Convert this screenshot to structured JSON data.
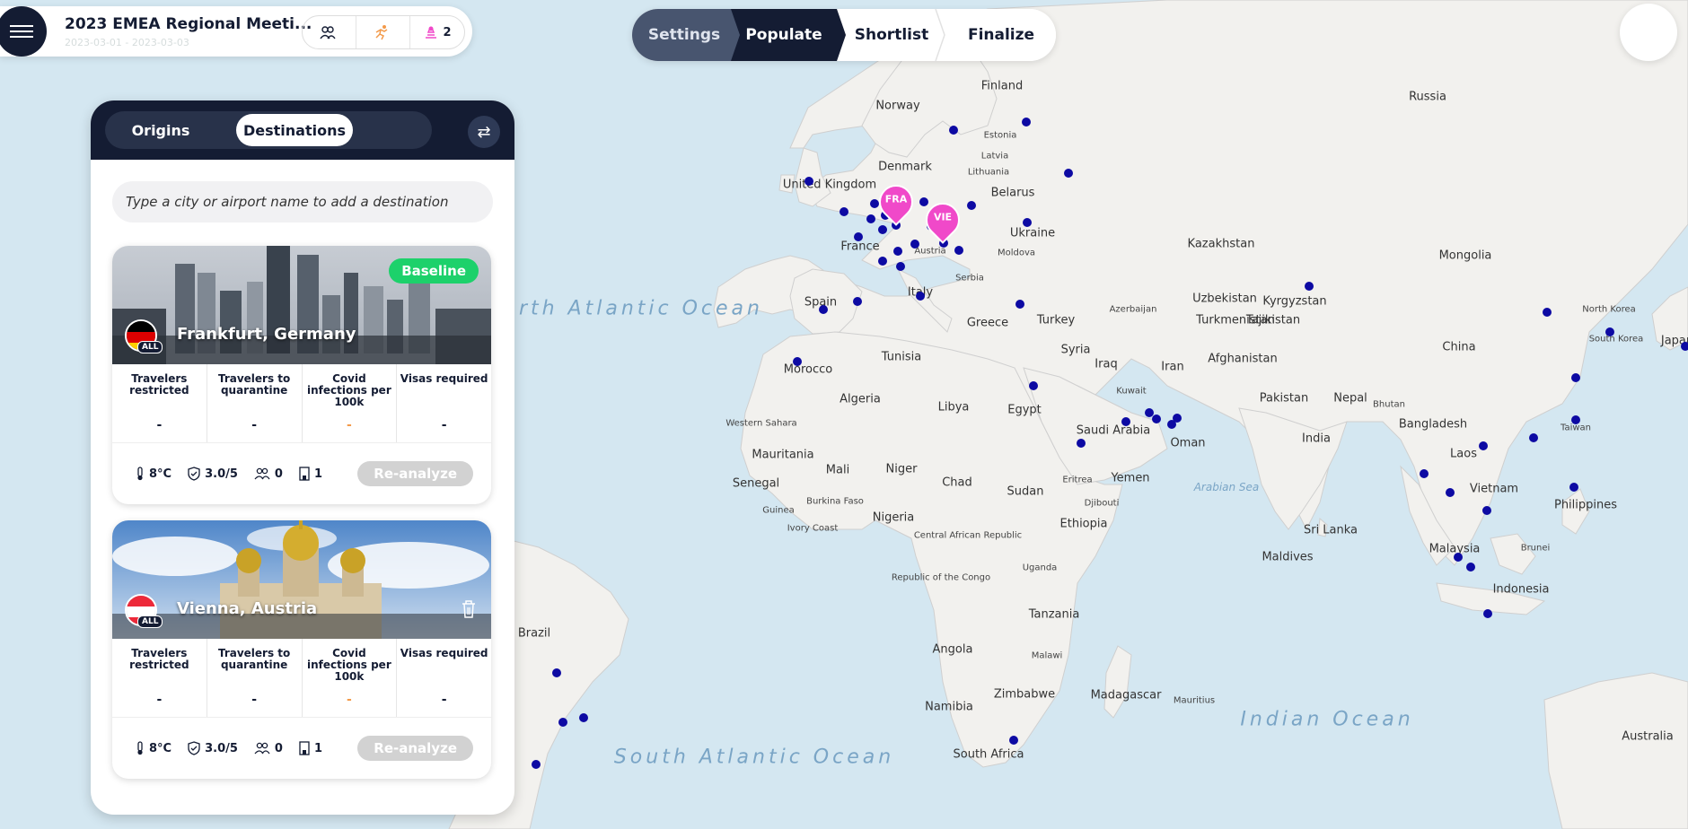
{
  "header": {
    "trip_title": "2023 EMEA Regional Meeti...",
    "trip_dates": "2023-03-01 - 2023-03-03",
    "chips": [
      {
        "icon": "travelers-icon",
        "label": ""
      },
      {
        "icon": "runner-icon",
        "label": ""
      },
      {
        "icon": "destinations-icon",
        "label": "2"
      }
    ]
  },
  "stepper": {
    "steps": [
      "Settings",
      "Populate",
      "Shortlist",
      "Finalize"
    ],
    "active": "Populate"
  },
  "panel": {
    "tabs": [
      "Origins",
      "Destinations"
    ],
    "active_tab": "Destinations",
    "search_placeholder": "Type a city or airport name to add a destination",
    "cards": [
      {
        "city": "Frankfurt, Germany",
        "badge": "Baseline",
        "flag_badge": "ALL",
        "stats": [
          {
            "label": "Travelers restricted",
            "value": "-"
          },
          {
            "label": "Travelers to quarantine",
            "value": "-"
          },
          {
            "label": "Covid infections per 100k",
            "value": "-"
          },
          {
            "label": "Visas required",
            "value": "-"
          }
        ],
        "temperature": "8°C",
        "safety": "3.0/5",
        "travelers": "0",
        "hotels": "1",
        "action": "Re-analyze"
      },
      {
        "city": "Vienna, Austria",
        "badge": "",
        "flag_badge": "ALL",
        "stats": [
          {
            "label": "Travelers restricted",
            "value": "-"
          },
          {
            "label": "Travelers to quarantine",
            "value": "-"
          },
          {
            "label": "Covid infections per 100k",
            "value": "-"
          },
          {
            "label": "Visas required",
            "value": "-"
          }
        ],
        "temperature": "8°C",
        "safety": "3.0/5",
        "travelers": "0",
        "hotels": "1",
        "action": "Re-analyze"
      }
    ]
  },
  "map": {
    "pins": [
      "FRA",
      "VIE"
    ],
    "oceans": [
      "North Atlantic Ocean",
      "South Atlantic Ocean",
      "Indian Ocean"
    ],
    "seas": [
      "Arabian Sea"
    ],
    "labels": [
      "Russia",
      "Finland",
      "Norway",
      "Estonia",
      "Latvia",
      "Lithuania",
      "Denmark",
      "United Kingdom",
      "Belarus",
      "Ukraine",
      "Moldova",
      "France",
      "Serbia",
      "Austria",
      "Spain",
      "Italy",
      "Greece",
      "Turkey",
      "Azerbaijan",
      "Kazakhstan",
      "Mongolia",
      "Uzbekistan",
      "Kyrgyzstan",
      "Turkmenistan",
      "Tajikistan",
      "Afghanistan",
      "Syria",
      "Iraq",
      "Iran",
      "Kuwait",
      "Tunisia",
      "Morocco",
      "Algeria",
      "Libya",
      "Egypt",
      "Saudi Arabia",
      "Oman",
      "Pakistan",
      "Nepal",
      "Bhutan",
      "Bangladesh",
      "India",
      "China",
      "North Korea",
      "South Korea",
      "Japan",
      "Taiwan",
      "Laos",
      "Vietnam",
      "Philippines",
      "Western Sahara",
      "Mauritania",
      "Mali",
      "Niger",
      "Chad",
      "Sudan",
      "Eritrea",
      "Yemen",
      "Djibouti",
      "Ethiopia",
      "Senegal",
      "Burkina Faso",
      "Guinea",
      "Ivory Coast",
      "Nigeria",
      "Central African Republic",
      "Republic of the Congo",
      "Uganda",
      "Tanzania",
      "Angola",
      "Malawi",
      "Zimbabwe",
      "Namibia",
      "Madagascar",
      "Mauritius",
      "South Africa",
      "Sri Lanka",
      "Maldives",
      "Malaysia",
      "Brunei",
      "Indonesia",
      "Australia",
      "Brazil"
    ]
  },
  "colors": {
    "navy": "#141c33",
    "pin": "#f049c9",
    "dot": "#0d0aa3",
    "baseline": "#1dd16b",
    "ocean": "#d4e7f1",
    "land": "#f2f1ee"
  }
}
